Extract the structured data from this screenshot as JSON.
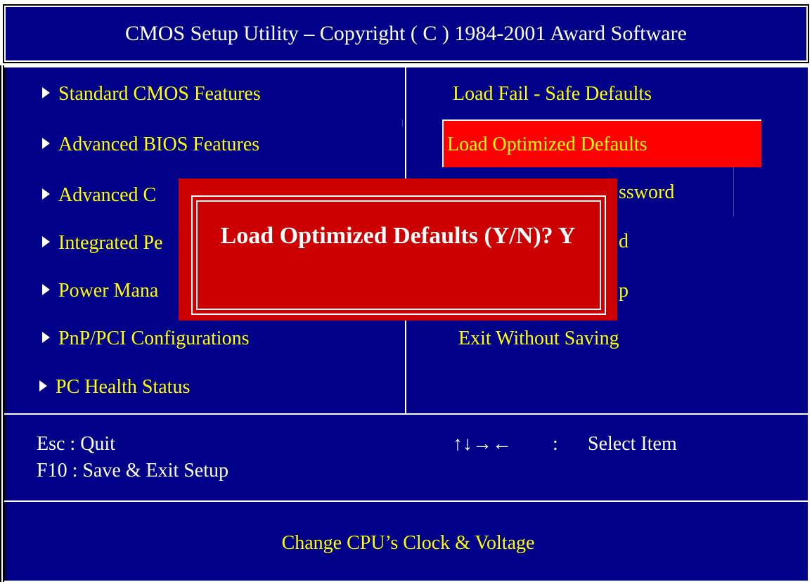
{
  "title": "CMOS Setup Utility – Copyright ( C ) 1984-2001 Award Software",
  "left_menu": [
    {
      "label": "Standard CMOS Features"
    },
    {
      "label": "Advanced BIOS Features"
    },
    {
      "label": "Advanced C"
    },
    {
      "label": "Integrated Pe"
    },
    {
      "label": "Power Mana"
    },
    {
      "label": "PnP/PCI Configurations"
    },
    {
      "label": "PC Health Status"
    }
  ],
  "right_menu": [
    {
      "label": "Load Fail - Safe Defaults"
    },
    {
      "label": "Load Optimized Defaults",
      "selected": true
    },
    {
      "label": "ssword"
    },
    {
      "label": "d"
    },
    {
      "label": "p"
    },
    {
      "label": "Exit Without Saving"
    }
  ],
  "dialog": {
    "message": "Load Optimized Defaults (Y/N)? Y"
  },
  "help": {
    "esc": "Esc : Quit",
    "f10": "F10 : Save & Exit Setup",
    "arrows": "↑↓→←",
    "separator": ":",
    "select": "Select Item"
  },
  "status": "Change CPU’s Clock & Voltage",
  "colors": {
    "background": "#000088",
    "menu_text": "#ffff00",
    "highlight": "#ff0000",
    "dialog": "#cc0000"
  }
}
